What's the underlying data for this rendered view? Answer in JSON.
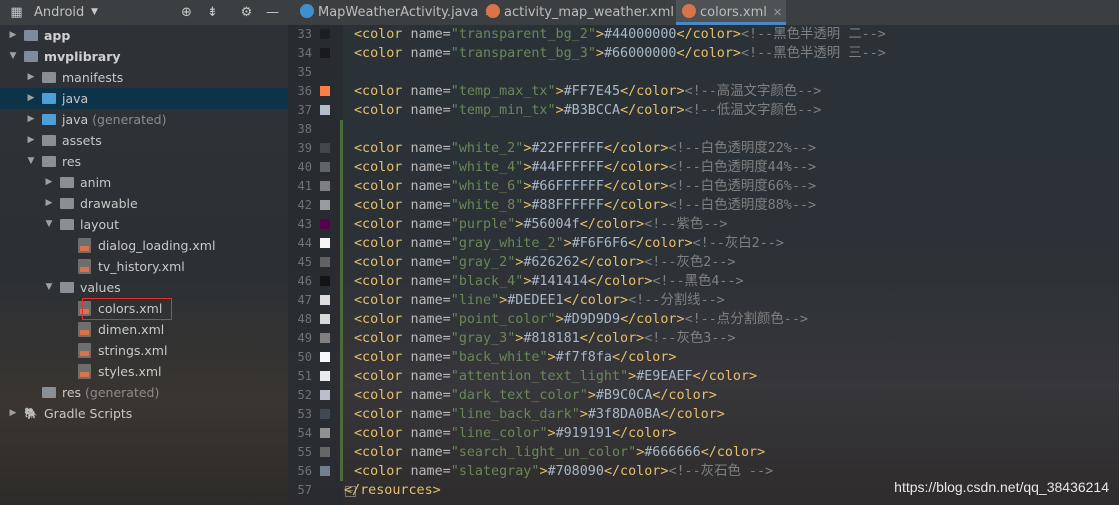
{
  "project_panel": {
    "view_label": "Android",
    "tree": [
      {
        "label": "app",
        "depth": 0,
        "arrow": "▶",
        "icon": "module",
        "bold": true
      },
      {
        "label": "mvplibrary",
        "depth": 0,
        "arrow": "▼",
        "icon": "module",
        "bold": true
      },
      {
        "label": "manifests",
        "depth": 1,
        "arrow": "▶",
        "icon": "folder"
      },
      {
        "label": "java",
        "depth": 1,
        "arrow": "▶",
        "icon": "folder-blue",
        "selected": true
      },
      {
        "label": "java",
        "suffix": "(generated)",
        "depth": 1,
        "arrow": "▶",
        "icon": "folder-blue"
      },
      {
        "label": "assets",
        "depth": 1,
        "arrow": "▶",
        "icon": "folder"
      },
      {
        "label": "res",
        "depth": 1,
        "arrow": "▼",
        "icon": "folder"
      },
      {
        "label": "anim",
        "depth": 2,
        "arrow": "▶",
        "icon": "folder"
      },
      {
        "label": "drawable",
        "depth": 2,
        "arrow": "▶",
        "icon": "folder"
      },
      {
        "label": "layout",
        "depth": 2,
        "arrow": "▼",
        "icon": "folder"
      },
      {
        "label": "dialog_loading.xml",
        "depth": 3,
        "arrow": "",
        "icon": "xml"
      },
      {
        "label": "tv_history.xml",
        "depth": 3,
        "arrow": "",
        "icon": "xml"
      },
      {
        "label": "values",
        "depth": 2,
        "arrow": "▼",
        "icon": "folder"
      },
      {
        "label": "colors.xml",
        "depth": 3,
        "arrow": "",
        "icon": "xml",
        "highlighted": true
      },
      {
        "label": "dimen.xml",
        "depth": 3,
        "arrow": "",
        "icon": "xml"
      },
      {
        "label": "strings.xml",
        "depth": 3,
        "arrow": "",
        "icon": "xml"
      },
      {
        "label": "styles.xml",
        "depth": 3,
        "arrow": "",
        "icon": "xml"
      },
      {
        "label": "res",
        "suffix": "(generated)",
        "depth": 1,
        "arrow": "",
        "icon": "folder"
      },
      {
        "label": "Gradle Scripts",
        "depth": 0,
        "arrow": "▶",
        "icon": "gradle"
      }
    ]
  },
  "tabs": [
    {
      "label": "MapWeatherActivity.java",
      "icon_color": "#3d8fd1",
      "active": false
    },
    {
      "label": "activity_map_weather.xml",
      "icon_color": "#d8734a",
      "active": false
    },
    {
      "label": "colors.xml",
      "icon_color": "#d8734a",
      "active": true
    }
  ],
  "editor": {
    "lines": [
      {
        "n": "33",
        "swatch": "#44000000",
        "name": "transparent_bg_2",
        "value": "#44000000",
        "comment": "<!--黑色半透明 二-->"
      },
      {
        "n": "34",
        "swatch": "#66000000",
        "name": "transparent_bg_3",
        "value": "#66000000",
        "comment": "<!--黑色半透明 三-->"
      },
      {
        "n": "35"
      },
      {
        "n": "36",
        "swatch": "#FF7E45",
        "name": "temp_max_tx",
        "value": "#FF7E45",
        "comment": "<!--高温文字颜色-->"
      },
      {
        "n": "37",
        "swatch": "#B3BCCA",
        "name": "temp_min_tx",
        "value": "#B3BCCA",
        "comment": "<!--低温文字颜色-->"
      },
      {
        "n": "38"
      },
      {
        "n": "39",
        "swatch": "#22FFFFFF",
        "name": "white_2",
        "value": "#22FFFFFF",
        "comment": "<!--白色透明度22%-->"
      },
      {
        "n": "40",
        "swatch": "#44FFFFFF",
        "name": "white_4",
        "value": "#44FFFFFF",
        "comment": "<!--白色透明度44%-->"
      },
      {
        "n": "41",
        "swatch": "#66FFFFFF",
        "name": "white_6",
        "value": "#66FFFFFF",
        "comment": "<!--白色透明度66%-->"
      },
      {
        "n": "42",
        "swatch": "#88FFFFFF",
        "name": "white_8",
        "value": "#88FFFFFF",
        "comment": "<!--白色透明度88%-->"
      },
      {
        "n": "43",
        "swatch": "#56004f",
        "name": "purple",
        "value": "#56004f",
        "comment": "<!--紫色-->"
      },
      {
        "n": "44",
        "swatch": "#F6F6F6",
        "name": "gray_white_2",
        "value": "#F6F6F6",
        "comment": "<!--灰白2-->"
      },
      {
        "n": "45",
        "swatch": "#626262",
        "name": "gray_2",
        "value": "#626262",
        "comment": "<!--灰色2-->"
      },
      {
        "n": "46",
        "swatch": "#141414",
        "name": "black_4",
        "value": "#141414",
        "comment": "<!--黑色4-->"
      },
      {
        "n": "47",
        "swatch": "#DEDEE1",
        "name": "line",
        "value": "#DEDEE1",
        "comment": "<!--分割线-->"
      },
      {
        "n": "48",
        "swatch": "#D9D9D9",
        "name": "point_color",
        "value": "#D9D9D9",
        "comment": "<!--点分割颜色-->"
      },
      {
        "n": "49",
        "swatch": "#818181",
        "name": "gray_3",
        "value": "#818181",
        "comment": "<!--灰色3-->"
      },
      {
        "n": "50",
        "swatch": "#f7f8fa",
        "name": "back_white",
        "value": "#f7f8fa",
        "comment": ""
      },
      {
        "n": "51",
        "swatch": "#E9EAEF",
        "name": "attention_text_light",
        "value": "#E9EAEF",
        "comment": ""
      },
      {
        "n": "52",
        "swatch": "#B9C0CA",
        "name": "dark_text_color",
        "value": "#B9C0CA",
        "comment": ""
      },
      {
        "n": "53",
        "swatch": "#3f8DA0BA",
        "name": "line_back_dark",
        "value": "#3f8DA0BA",
        "comment": ""
      },
      {
        "n": "54",
        "swatch": "#919191",
        "name": "line_color",
        "value": "#919191",
        "comment": ""
      },
      {
        "n": "55",
        "swatch": "#666666",
        "name": "search_light_un_color",
        "value": "#666666",
        "comment": ""
      },
      {
        "n": "56",
        "swatch": "#708090",
        "name": "slategray",
        "value": "#708090",
        "comment": "<!--灰石色 -->"
      },
      {
        "n": "57",
        "closing": "</resources>"
      }
    ]
  },
  "watermark": "https://blog.csdn.net/qq_38436214",
  "colors": {
    "accent": "#4a88c7",
    "selection": "#0d3349",
    "highlight_border": "#e03030"
  }
}
